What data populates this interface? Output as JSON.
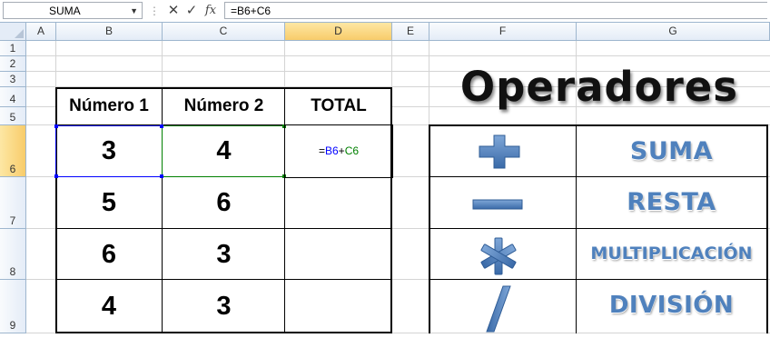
{
  "formula_bar": {
    "name_box": "SUMA",
    "formula": "=B6+C6",
    "cancel_icon": "✕",
    "enter_icon": "✓",
    "fx_icon": "fx"
  },
  "columns": [
    "A",
    "B",
    "C",
    "D",
    "E",
    "F",
    "G"
  ],
  "rows": [
    "1",
    "2",
    "3",
    "4",
    "5",
    "6",
    "7",
    "8",
    "9"
  ],
  "table": {
    "headers": [
      "Número 1",
      "Número 2",
      "TOTAL"
    ],
    "rows": [
      {
        "n1": "3",
        "n2": "4",
        "total": "=B6+C6"
      },
      {
        "n1": "5",
        "n2": "6",
        "total": ""
      },
      {
        "n1": "6",
        "n2": "3",
        "total": ""
      },
      {
        "n1": "4",
        "n2": "3",
        "total": ""
      }
    ],
    "formula_parts": {
      "eq": "=",
      "ref1": "B6",
      "plus": "+",
      "ref2": "C6"
    }
  },
  "operators": {
    "title": "Operadores",
    "items": [
      {
        "icon": "plus-icon",
        "label": "SUMA"
      },
      {
        "icon": "minus-icon",
        "label": "RESTA"
      },
      {
        "icon": "asterisk-icon",
        "label": "MULTIPLICACIÓN"
      },
      {
        "icon": "slash-icon",
        "label": "DIVISIÓN"
      }
    ]
  },
  "colors": {
    "accent": "#4f81bd",
    "ref_blue": "#0000ff",
    "ref_green": "#008000",
    "selected_header": "#f8cc6a"
  }
}
